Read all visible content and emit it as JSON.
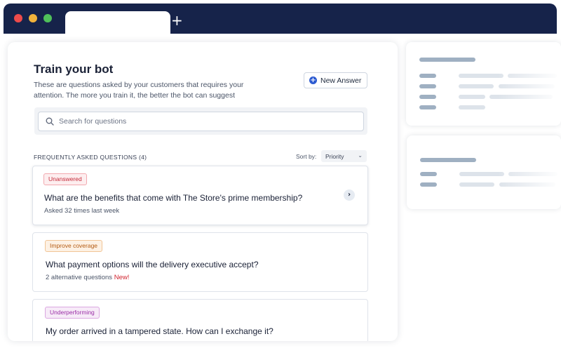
{
  "browser": {
    "new_tab_label": "+"
  },
  "main": {
    "title": "Train your bot",
    "subtitle": "These are questions asked by your customers that requires your attention. The more you train it, the better the bot can suggest",
    "new_answer_label": "New Answer",
    "search": {
      "placeholder": "Search for questions"
    },
    "faq_heading": "FREQUENTLY ASKED QUESTIONS (4)",
    "sort": {
      "label": "Sort by:",
      "value": "Priority"
    },
    "questions": [
      {
        "badge": "Unanswered",
        "question": "What are the benefits that come with The Store's prime membership?",
        "meta": "Asked 32 times last week",
        "new": ""
      },
      {
        "badge": "Improve coverage",
        "question": "What payment options will the delivery executive accept?",
        "meta": "2 alternative questions",
        "new": "New!"
      },
      {
        "badge": "Underperforming",
        "question": "My order arrived in a tampered state. How can I exchange it?",
        "meta": "",
        "new": ""
      }
    ]
  },
  "colors": {
    "chrome": "#16234a",
    "accent": "#2d5bd1",
    "badge_unanswered": "#c42b3a",
    "badge_improve": "#b45b12",
    "badge_underperforming": "#9a2ea6"
  }
}
